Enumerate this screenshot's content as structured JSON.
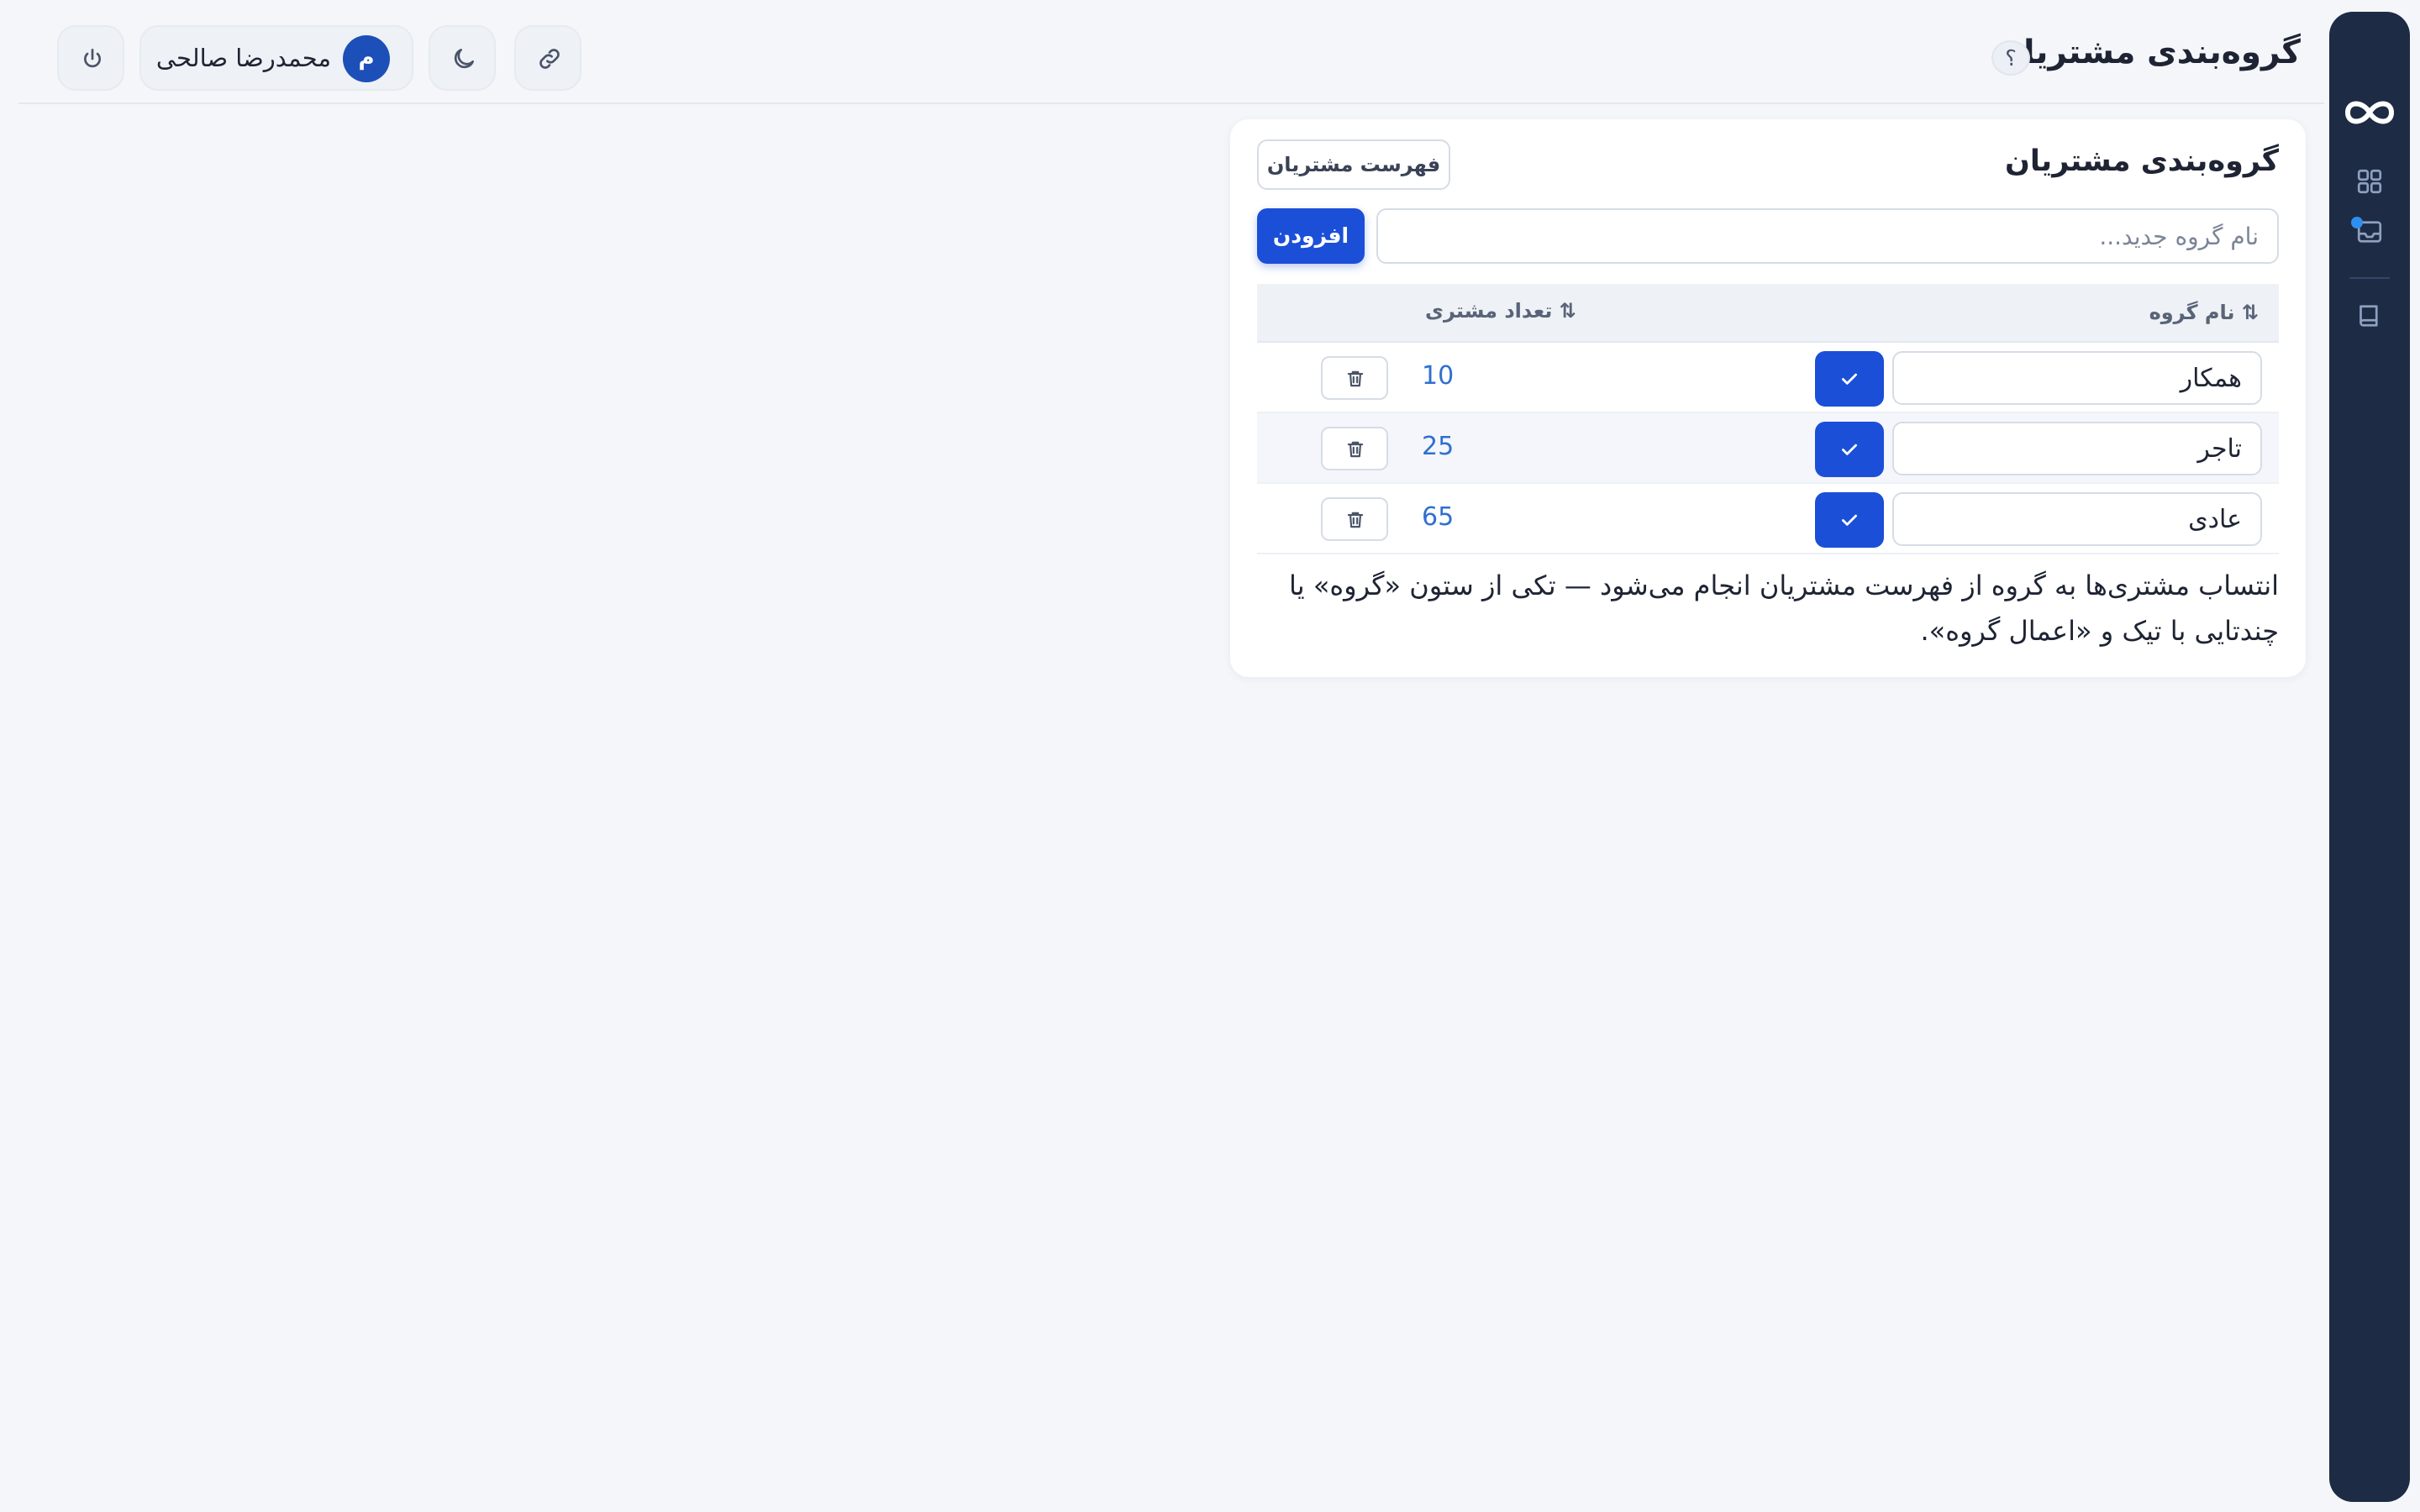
{
  "header": {
    "title": "گروه‌بندی مشتریان",
    "help_label": "؟",
    "user_name": "محمدرضا صالحی",
    "user_initial": "م"
  },
  "card": {
    "title": "گروه‌بندی مشتریان",
    "customer_list_label": "فهرست مشتریان",
    "new_group_placeholder": "نام گروه جدید...",
    "add_label": "افزودن",
    "note": "انتساب مشتری‌ها به گروه از فهرست مشتریان انجام می‌شود — تکی از ستون «گروه» یا چندتایی با تیک و «اعمال گروه»."
  },
  "table": {
    "columns": {
      "name": "⇅ نام گروه",
      "count": "⇅ تعداد مشتری"
    },
    "rows": [
      {
        "name": "همکار",
        "count": "10"
      },
      {
        "name": "تاجر",
        "count": "25"
      },
      {
        "name": "عادی",
        "count": "65"
      }
    ]
  },
  "icons": {
    "logo": "infinity-logo-icon",
    "dashboard": "dashboard-grid-icon",
    "inbox": "inbox-icon",
    "book": "book-icon",
    "link": "link-icon",
    "theme": "moon-icon",
    "power": "power-icon",
    "save": "check-icon",
    "delete": "trash-icon"
  },
  "colors": {
    "sidebar": "#1d2b44",
    "primary": "#1b4fd8",
    "count_text": "#2f6fd0",
    "notification_dot": "#2e8ff0"
  }
}
